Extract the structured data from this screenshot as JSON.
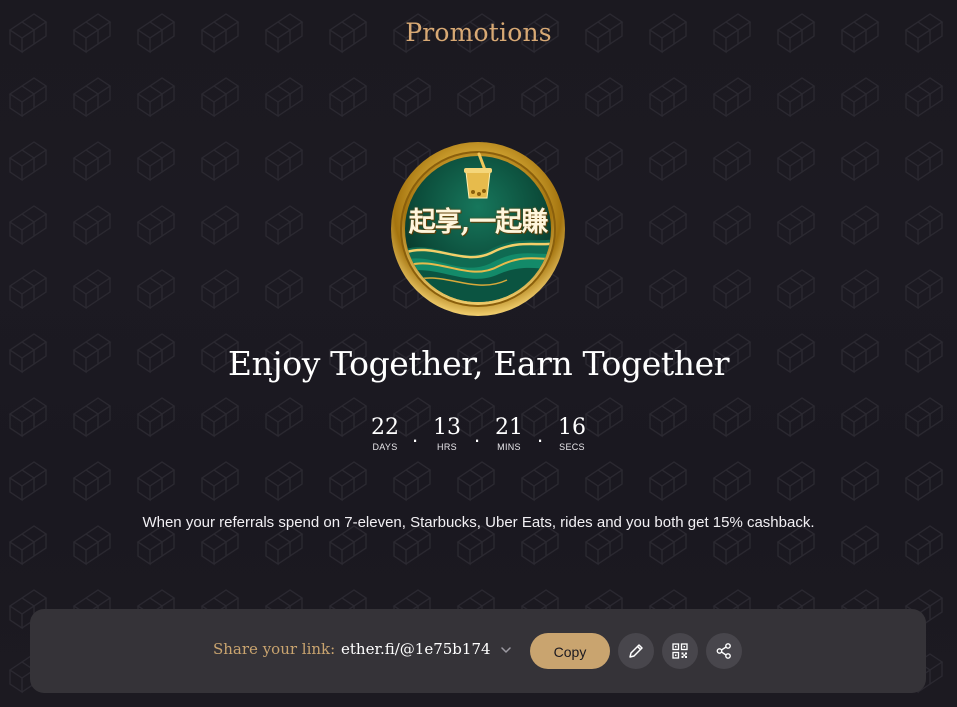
{
  "header": {
    "title": "Promotions"
  },
  "promo": {
    "badge_text": "起享,一起賺",
    "headline": "Enjoy Together, Earn Together",
    "description": "When your referrals spend on 7-eleven, Starbucks, Uber Eats, rides and you both get 15% cashback."
  },
  "countdown": {
    "units": [
      {
        "value": "22",
        "label": "DAYS"
      },
      {
        "value": "13",
        "label": "HRS"
      },
      {
        "value": "21",
        "label": "MINS"
      },
      {
        "value": "16",
        "label": "SECS"
      }
    ],
    "separator": "."
  },
  "share": {
    "label": "Share your link:",
    "link": "ether.fi/@1e75b174",
    "copy_label": "Copy",
    "icons": [
      "chevron-down-icon",
      "pencil-icon",
      "qr-code-icon",
      "share-icon"
    ]
  },
  "colors": {
    "background": "#1b1920",
    "accent_gold": "#c9a46f",
    "title_gold": "#d8a974",
    "bar_background": "#353338",
    "icon_button": "#48464c",
    "badge_green": "#0f5a45"
  }
}
